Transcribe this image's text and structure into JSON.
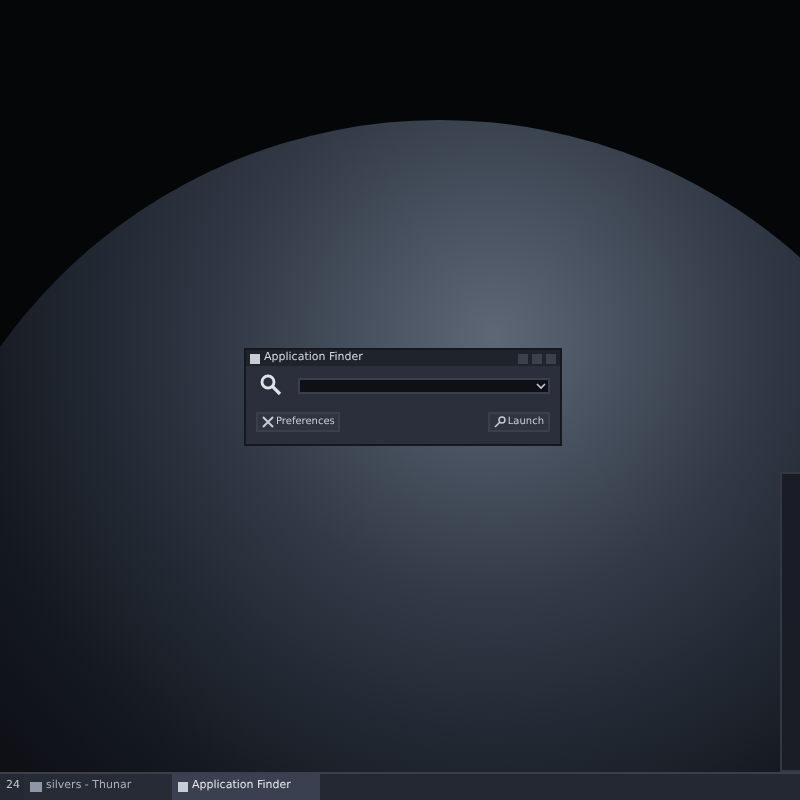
{
  "dialog": {
    "title": "Application Finder",
    "buttons": [
      {
        "kind": "preferences",
        "label": "Preferences"
      },
      {
        "kind": "launch",
        "label": "Launch"
      }
    ]
  },
  "taskbar": {
    "clock": "24",
    "tasks": [
      {
        "label": "silvers - Thunar",
        "kind": "folder",
        "selected": false
      },
      {
        "label": "Application Finder",
        "kind": "app",
        "selected": true
      }
    ]
  }
}
